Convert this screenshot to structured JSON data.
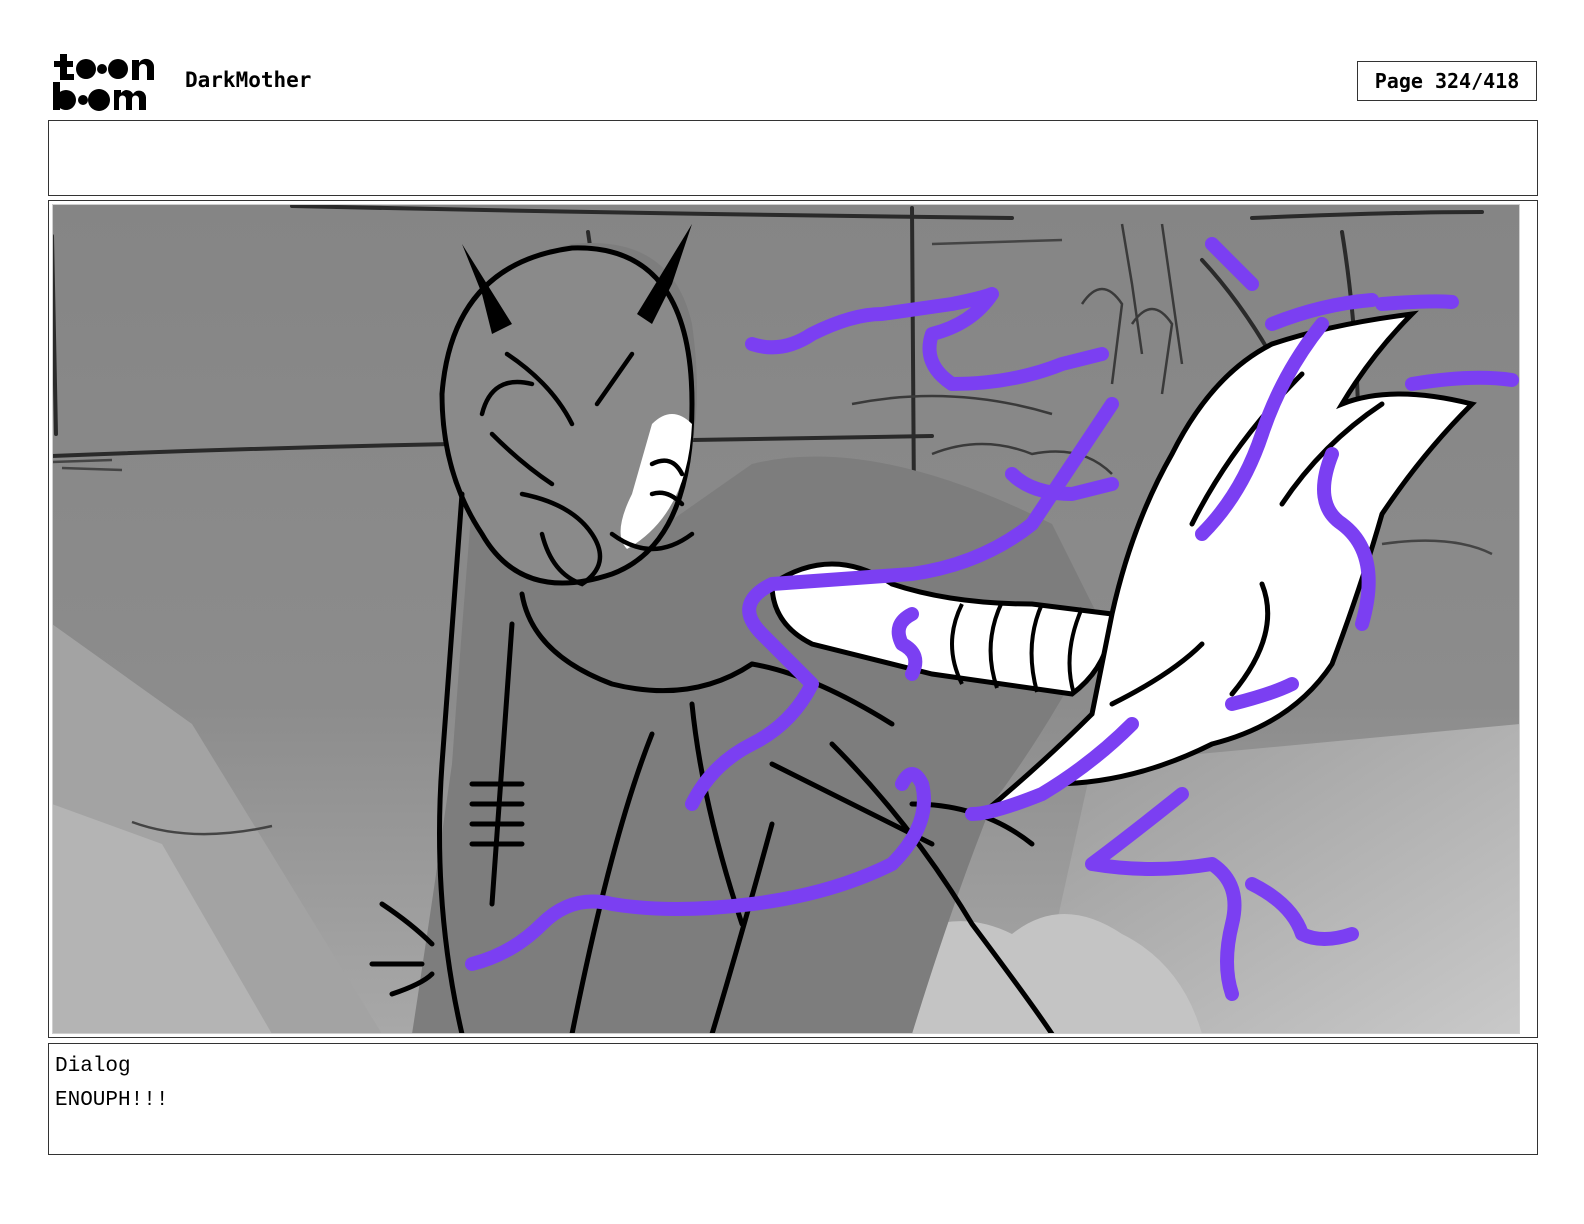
{
  "header": {
    "logo": {
      "line1": "to•n",
      "line2": "b••m"
    },
    "project_title": "DarkMother",
    "page_label": "Page 324/418"
  },
  "panel": {
    "description_icon": "storyboard-sketch"
  },
  "dialog": {
    "label": "Dialog",
    "text": "ENOUPH!!!"
  },
  "colors": {
    "energy": "#7b3ff2",
    "sketch_line": "#000000",
    "background_gray": "#8a8a8a"
  }
}
